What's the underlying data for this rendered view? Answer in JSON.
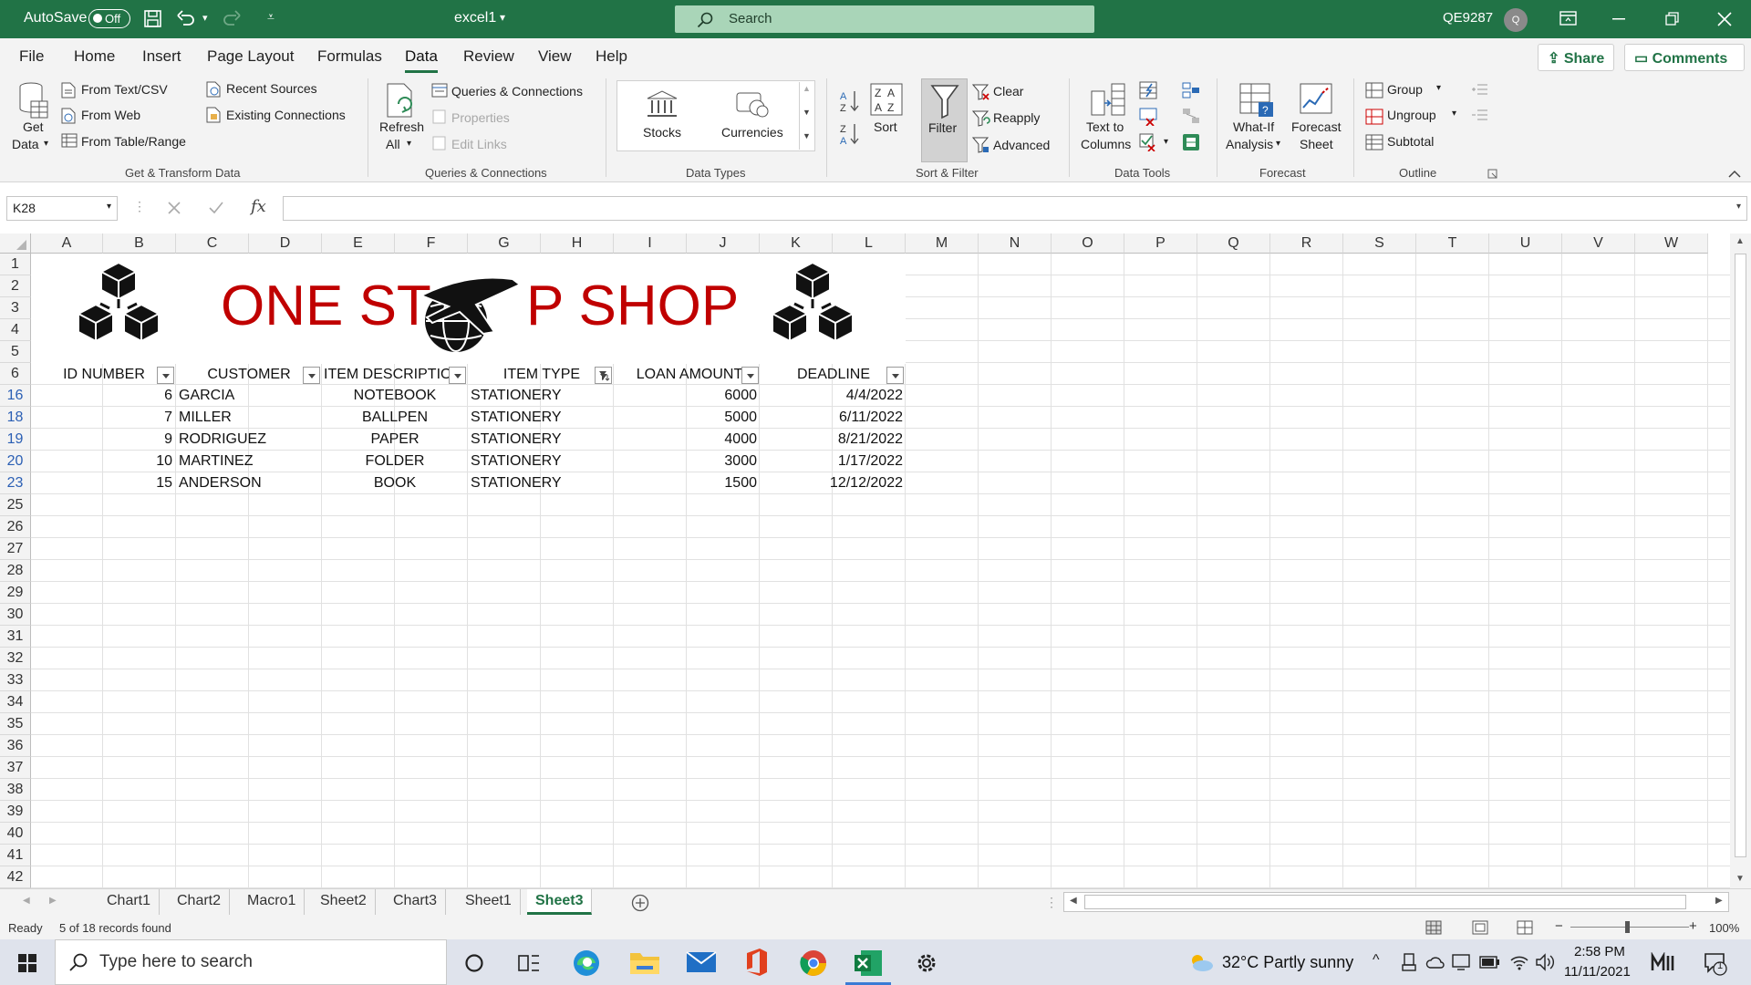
{
  "titlebar": {
    "autosave_label": "AutoSave",
    "autosave_state": "Off",
    "filename": "excel1",
    "search_placeholder": "Search",
    "user": "QE9287",
    "avatar_initial": "Q"
  },
  "menu": {
    "tabs": [
      "File",
      "Home",
      "Insert",
      "Page Layout",
      "Formulas",
      "Data",
      "Review",
      "View",
      "Help"
    ],
    "active": "Data",
    "share": "Share",
    "comments": "Comments"
  },
  "ribbon": {
    "get_data": [
      "Get",
      "Data"
    ],
    "from_text": "From Text/CSV",
    "from_web": "From Web",
    "from_table": "From Table/Range",
    "recent_sources": "Recent Sources",
    "existing_connections": "Existing Connections",
    "group_get": "Get & Transform Data",
    "refresh": [
      "Refresh",
      "All"
    ],
    "queries_connections": "Queries & Connections",
    "properties": "Properties",
    "edit_links": "Edit Links",
    "group_queries": "Queries & Connections",
    "stocks": "Stocks",
    "currencies": "Currencies",
    "group_types": "Data Types",
    "sort": "Sort",
    "filter": "Filter",
    "clear": "Clear",
    "reapply": "Reapply",
    "advanced": "Advanced",
    "group_sort": "Sort & Filter",
    "text_to_columns": [
      "Text to",
      "Columns"
    ],
    "group_tools": "Data Tools",
    "whatif": [
      "What-If",
      "Analysis"
    ],
    "forecast_sheet": [
      "Forecast",
      "Sheet"
    ],
    "group_forecast": "Forecast",
    "group": "Group",
    "ungroup": "Ungroup",
    "subtotal": "Subtotal",
    "group_outline": "Outline"
  },
  "formula_bar": {
    "name_box": "K28",
    "fx": "fx",
    "value": ""
  },
  "sheet": {
    "columns": [
      "A",
      "B",
      "C",
      "D",
      "E",
      "F",
      "G",
      "H",
      "I",
      "J",
      "K",
      "L",
      "M",
      "N",
      "O",
      "P",
      "Q",
      "R",
      "S",
      "T",
      "U",
      "V",
      "W"
    ],
    "rows": [
      "1",
      "2",
      "3",
      "4",
      "5",
      "6",
      "16",
      "18",
      "19",
      "20",
      "23",
      "25",
      "26",
      "27",
      "28",
      "29",
      "30",
      "31",
      "32",
      "33",
      "34",
      "35",
      "36",
      "37",
      "38",
      "39",
      "40",
      "41",
      "42"
    ],
    "banner_left": "ONE ST",
    "banner_right": "P SHOP",
    "headers": [
      "ID NUMBER",
      "CUSTOMER",
      "ITEM DESCRIPTIO",
      "ITEM TYPE",
      "LOAN AMOUNT",
      "DEADLINE"
    ],
    "data": [
      {
        "id": "6",
        "customer": "GARCIA",
        "item": "NOTEBOOK",
        "type": "STATIONERY",
        "loan": "6000",
        "deadline": "4/4/2022"
      },
      {
        "id": "7",
        "customer": "MILLER",
        "item": "BALLPEN",
        "type": "STATIONERY",
        "loan": "5000",
        "deadline": "6/11/2022"
      },
      {
        "id": "9",
        "customer": "RODRIGUEZ",
        "item": "PAPER",
        "type": "STATIONERY",
        "loan": "4000",
        "deadline": "8/21/2022"
      },
      {
        "id": "10",
        "customer": "MARTINEZ",
        "item": "FOLDER",
        "type": "STATIONERY",
        "loan": "3000",
        "deadline": "1/17/2022"
      },
      {
        "id": "15",
        "customer": "ANDERSON",
        "item": "BOOK",
        "type": "STATIONERY",
        "loan": "1500",
        "deadline": "12/12/2022"
      }
    ]
  },
  "sheet_tabs": [
    "Chart1",
    "Chart2",
    "Macro1",
    "Sheet2",
    "Chart3",
    "Sheet1",
    "Sheet3"
  ],
  "active_sheet": "Sheet3",
  "status": {
    "ready": "Ready",
    "records": "5 of 18 records found",
    "zoom": "100%"
  },
  "taskbar": {
    "search_placeholder": "Type here to search",
    "weather": "32°C  Partly sunny",
    "time": "2:58 PM",
    "date": "11/11/2021",
    "notif_count": "1"
  },
  "colors": {
    "excel_green": "#217346",
    "banner_red": "#c00000",
    "filtered_row_blue": "#2b5fb4"
  }
}
